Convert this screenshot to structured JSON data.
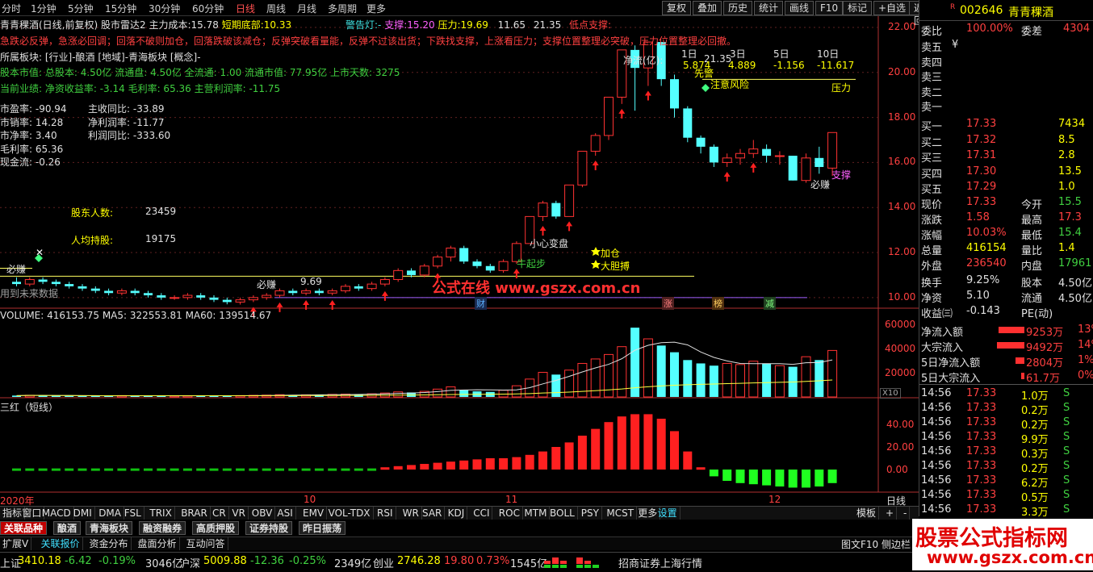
{
  "topbar": {
    "periods": [
      "分时",
      "1分钟",
      "5分钟",
      "15分钟",
      "30分钟",
      "60分钟",
      "日线",
      "周线",
      "月线",
      "多周期",
      "更多"
    ],
    "active": "日线",
    "buttons": [
      "复权",
      "叠加",
      "历史",
      "统计",
      "画线",
      "F10",
      "标记",
      "+自选",
      "返回"
    ]
  },
  "head": {
    "title": "青青稞酒(日线,前复权)",
    "indicator": "股市雷达2",
    "cost_label": "主力成本:",
    "cost": "15.78",
    "bottom_label": "短期底部:",
    "bottom": "10.33",
    "alarm": "警告灯:-",
    "support_label": "支撑:",
    "support": "15.20",
    "pressure_label": "压力:",
    "pressure": "19.69",
    "v1": "11.65",
    "v2": "21.35",
    "low_label": "低点支撑:"
  },
  "notice": "急跌必反弹，急涨必回调；回落不破则加仓，回落跌破该减仓；反弹突破看量能，反弹不过该出货；下跌找支撑，上涨看压力；支撑位置整理必突破，压力位置整理必回撤。",
  "sectors": "所属板块: [行业]-酿酒 [地域]-青海板块 [概念]-",
  "capital": "股本市值: 总股本: 4.50亿 流通盘: 4.50亿 全流通: 1.00 流通市值: 77.95亿 上市天数: 3275",
  "perf": "当前业绩: 净资收益率: -3.14 毛利率: 65.36 主营利润率: -11.75",
  "fin_left": [
    "市盈率: -90.94",
    "市销率: 14.28",
    "市净率: 3.40",
    "毛利率: 65.36",
    "现金流: -0.26"
  ],
  "fin_right": [
    "主收同比: -33.89",
    "净利润率: -11.77",
    "利润同比: -333.60"
  ],
  "holders": {
    "l1": "股东人数:",
    "v1": "23459",
    "l2": "人均持股:",
    "v2": "19175"
  },
  "netflow": {
    "label": "净流(亿):",
    "h1": "1日",
    "h3": "3日",
    "h5": "5日",
    "h10": "10日",
    "d1": "5.874",
    "d3": "4.889",
    "d5": "-1.156",
    "d10": "-11.617",
    "tag": "先警",
    "p21": "21.35"
  },
  "chart_text": {
    "risk": "注意风险",
    "pressure": "压力",
    "support": "支撑",
    "bimian": "必赚",
    "bimian2": "必赚",
    "bimian3": "必赚",
    "xiaoxin": "小心变盘",
    "jiacang": "加仓",
    "dadan": "大胆搏",
    "niuqi": "牛起步",
    "v969": "9.69",
    "future": "用到未来数据",
    "cai": "财",
    "zhang": "涨",
    "bang": "榜",
    "jian": "减",
    "watermark1": "公式在线 www.gszx.com.cn"
  },
  "yaxis": [
    "22.00",
    "20.00",
    "18.00",
    "16.00",
    "14.00",
    "12.00",
    "10.00"
  ],
  "volume": {
    "title": "VOLUME: 416153.75  MA5: 322553.81  MA60: 139514.67",
    "ticks": [
      "60000",
      "40000",
      "20000"
    ],
    "x10": "X10"
  },
  "sanhong": {
    "title": "三红（短线）",
    "ticks": [
      "40.00",
      "20.00",
      "0.00"
    ]
  },
  "xaxis": [
    "2020年",
    "10",
    "11",
    "12"
  ],
  "xaxis_right": "日线",
  "tabs": [
    "指标",
    "窗口",
    "MACD",
    "DMI",
    "DMA",
    "FSL",
    "TRIX",
    "BRAR",
    "CR",
    "VR",
    "OBV",
    "ASI",
    "EMV",
    "VOL-TDX",
    "RSI",
    "WR",
    "SAR",
    "KDJ",
    "CCI",
    "ROC",
    "MTM",
    "BOLL",
    "PSY",
    "MCST",
    "更多",
    "设置"
  ],
  "tabs_right": [
    "模板",
    "+",
    "-"
  ],
  "cats": [
    "关联品种",
    "酿酒",
    "青海板块",
    "融资融券",
    "高质押股",
    "证券持股",
    "昨日振荡"
  ],
  "infobar": [
    "扩展V",
    "关联报价",
    "资金分布",
    "盘面分析",
    "互动问答"
  ],
  "infobar_right": "图文F10 侧边栏",
  "status": {
    "sh_label": "上证",
    "sh": "3410.18",
    "sh_c": "-6.42",
    "sh_p": "-0.19%",
    "sh_v": "3046亿",
    "sz_label": "沪深",
    "sz": "5009.88",
    "sz_c": "-12.36",
    "sz_p": "-0.25%",
    "sz_v": "2349亿",
    "cy_label": "创业",
    "cy": "2746.28",
    "cy_c": "19.80",
    "cy_p": "0.73%",
    "cy_v": "1545亿",
    "broker": "招商证券上海行情"
  },
  "watermark2": {
    "l1": "股票公式指标网",
    "l2": "www.gszx.com.cn"
  },
  "right": {
    "code": "002646",
    "name": "青青稞酒",
    "r": "R",
    "wb": {
      "l": "委比",
      "v": "100.00%",
      "l2": "委差",
      "v2": "4304"
    },
    "asks": [
      {
        "l": "卖五",
        "p": "¥",
        "v": ""
      },
      {
        "l": "卖四",
        "p": "",
        "v": ""
      },
      {
        "l": "卖三",
        "p": "",
        "v": ""
      },
      {
        "l": "卖二",
        "p": "",
        "v": ""
      },
      {
        "l": "卖一",
        "p": "",
        "v": ""
      }
    ],
    "bids": [
      {
        "l": "买一",
        "p": "17.33",
        "v": "7434"
      },
      {
        "l": "买二",
        "p": "17.32",
        "v": "8.5"
      },
      {
        "l": "买三",
        "p": "17.31",
        "v": "2.8"
      },
      {
        "l": "买四",
        "p": "17.30",
        "v": "13.5"
      },
      {
        "l": "买五",
        "p": "17.29",
        "v": "1.0"
      }
    ],
    "quote": [
      {
        "l": "现价",
        "v": "17.33",
        "l2": "今开",
        "v2": "15.5"
      },
      {
        "l": "涨跌",
        "v": "1.58",
        "l2": "最高",
        "v2": "17.3"
      },
      {
        "l": "涨幅",
        "v": "10.03%",
        "l2": "最低",
        "v2": "15.4"
      },
      {
        "l": "总量",
        "v": "416154",
        "l2": "量比",
        "v2": "1.4"
      },
      {
        "l": "外盘",
        "v": "236540",
        "l2": "内盘",
        "v2": "17961"
      }
    ],
    "quote2": [
      {
        "l": "换手",
        "v": "9.25%",
        "l2": "股本",
        "v2": "4.50亿"
      },
      {
        "l": "净资",
        "v": "5.10",
        "l2": "流通",
        "v2": "4.50亿"
      },
      {
        "l": "收益㈢",
        "v": "-0.143",
        "l2": "PE(动)",
        "v2": ""
      }
    ],
    "flows": [
      {
        "l": "净流入额",
        "v": "9253万",
        "p": "13%",
        "bar": 0.9
      },
      {
        "l": "大宗流入",
        "v": "9492万",
        "p": "14%",
        "bar": 0.95
      },
      {
        "l": "5日净流入额",
        "v": "2804万",
        "p": "1%",
        "bar": 0.3
      },
      {
        "l": "5日大宗流入",
        "v": "61.7万",
        "p": "0%",
        "bar": 0.1
      }
    ],
    "ticks": [
      {
        "t": "14:56",
        "p": "17.33",
        "v": "1.0万",
        "s": "S"
      },
      {
        "t": "14:56",
        "p": "17.33",
        "v": "0.2万",
        "s": "S"
      },
      {
        "t": "14:56",
        "p": "17.33",
        "v": "0.2万",
        "s": "S"
      },
      {
        "t": "14:56",
        "p": "17.33",
        "v": "9.9万",
        "s": "S"
      },
      {
        "t": "14:56",
        "p": "17.33",
        "v": "0.3万",
        "s": "S"
      },
      {
        "t": "14:56",
        "p": "17.33",
        "v": "0.2万",
        "s": "S"
      },
      {
        "t": "14:56",
        "p": "17.33",
        "v": "6.2万",
        "s": "S"
      },
      {
        "t": "14:56",
        "p": "17.33",
        "v": "0.5万",
        "s": "S"
      },
      {
        "t": "14:56",
        "p": "17.33",
        "v": "3.3万",
        "s": "S"
      }
    ]
  },
  "colors": {
    "up": "#ff3232",
    "down": "#54ffff",
    "ma": "#ffff40",
    "bg": "#000000"
  },
  "chart_data": {
    "type": "candlestick",
    "price": [
      [
        10.7,
        10.6,
        10.9,
        10.5
      ],
      [
        10.6,
        10.8,
        10.9,
        10.5
      ],
      [
        10.8,
        10.7,
        10.9,
        10.6
      ],
      [
        10.7,
        10.6,
        10.8,
        10.5
      ],
      [
        10.6,
        10.5,
        10.7,
        10.4
      ],
      [
        10.5,
        10.4,
        10.6,
        10.3
      ],
      [
        10.4,
        10.3,
        10.5,
        10.2
      ],
      [
        10.3,
        10.2,
        10.4,
        10.1
      ],
      [
        10.2,
        10.3,
        10.4,
        10.1
      ],
      [
        10.3,
        10.2,
        10.4,
        10.1
      ],
      [
        10.2,
        10.1,
        10.3,
        10.0
      ],
      [
        10.1,
        10.0,
        10.2,
        9.9
      ],
      [
        10.0,
        10.0,
        10.1,
        9.9
      ],
      [
        10.0,
        10.1,
        10.2,
        9.9
      ],
      [
        10.1,
        10.0,
        10.2,
        9.9
      ],
      [
        10.0,
        9.9,
        10.1,
        9.8
      ],
      [
        9.9,
        9.8,
        10.0,
        9.7
      ],
      [
        9.8,
        9.9,
        10.0,
        9.69
      ],
      [
        9.9,
        10.0,
        10.1,
        9.8
      ],
      [
        10.0,
        10.1,
        10.2,
        9.9
      ],
      [
        10.1,
        10.3,
        10.4,
        10.0
      ],
      [
        10.3,
        10.2,
        10.4,
        10.1
      ],
      [
        10.2,
        10.3,
        10.4,
        10.1
      ],
      [
        10.3,
        10.2,
        10.4,
        10.1
      ],
      [
        10.2,
        10.3,
        10.4,
        10.1
      ],
      [
        10.3,
        10.5,
        10.6,
        10.2
      ],
      [
        10.5,
        10.4,
        10.6,
        10.3
      ],
      [
        10.4,
        10.6,
        10.7,
        10.3
      ],
      [
        10.6,
        10.8,
        10.9,
        10.5
      ],
      [
        10.8,
        11.2,
        11.3,
        10.7
      ],
      [
        11.2,
        11.0,
        11.3,
        10.9
      ],
      [
        11.0,
        11.4,
        11.5,
        10.9
      ],
      [
        11.4,
        11.8,
        11.9,
        11.3
      ],
      [
        11.8,
        12.2,
        12.3,
        11.6
      ],
      [
        12.2,
        11.6,
        12.3,
        11.5
      ],
      [
        11.6,
        11.4,
        11.7,
        11.3
      ],
      [
        11.4,
        11.2,
        11.5,
        11.1
      ],
      [
        11.2,
        11.6,
        11.7,
        11.1
      ],
      [
        11.6,
        12.4,
        12.5,
        11.5
      ],
      [
        12.4,
        13.6,
        13.6,
        12.4
      ],
      [
        13.6,
        14.2,
        14.3,
        13.4
      ],
      [
        14.2,
        13.6,
        14.3,
        13.5
      ],
      [
        13.6,
        15.0,
        15.0,
        13.6
      ],
      [
        15.0,
        16.5,
        16.5,
        14.9
      ],
      [
        16.5,
        17.2,
        17.3,
        16.3
      ],
      [
        17.2,
        18.9,
        18.9,
        17.0
      ],
      [
        18.9,
        21.0,
        21.0,
        18.6
      ],
      [
        21.0,
        20.2,
        21.2,
        18.3
      ],
      [
        20.2,
        21.35,
        21.35,
        19.4
      ],
      [
        21.35,
        19.7,
        21.35,
        19.4
      ],
      [
        19.7,
        18.4,
        19.9,
        18.0
      ],
      [
        18.4,
        17.1,
        18.5,
        16.9
      ],
      [
        17.1,
        16.7,
        17.2,
        16.4
      ],
      [
        16.7,
        16.0,
        16.8,
        15.8
      ],
      [
        16.0,
        16.2,
        16.4,
        15.8
      ],
      [
        16.2,
        16.4,
        16.6,
        15.9
      ],
      [
        16.4,
        16.6,
        17.0,
        16.2
      ],
      [
        16.6,
        16.3,
        16.8,
        16.0
      ],
      [
        16.3,
        16.3,
        16.5,
        15.9
      ],
      [
        16.3,
        15.2,
        16.3,
        15.2
      ],
      [
        15.2,
        16.2,
        16.4,
        15.1
      ],
      [
        16.2,
        15.8,
        16.7,
        15.5
      ],
      [
        15.75,
        17.33,
        17.33,
        15.4
      ]
    ],
    "volume": [
      1200,
      1500,
      1300,
      1100,
      1000,
      900,
      950,
      1000,
      1200,
      1100,
      900,
      1000,
      950,
      1100,
      1300,
      1000,
      900,
      1200,
      1400,
      1600,
      2000,
      1800,
      1900,
      2100,
      2300,
      2500,
      2400,
      2800,
      3500,
      4500,
      4000,
      5000,
      7000,
      9000,
      6000,
      5000,
      4500,
      6000,
      10000,
      16000,
      22000,
      20000,
      24000,
      30000,
      34000,
      38000,
      45000,
      62000,
      52000,
      46000,
      40000,
      33000,
      30000,
      28000,
      30000,
      29000,
      32000,
      30000,
      28000,
      27000,
      36000,
      33000,
      41600
    ],
    "ma5_desc": "MA5 line over volume",
    "sanhong": [
      1,
      1,
      1,
      1,
      1,
      1,
      1,
      1,
      1,
      1,
      1,
      1,
      1,
      1,
      1,
      1,
      1,
      1,
      1,
      1,
      1,
      1,
      1,
      1,
      1,
      1,
      1,
      1,
      2,
      3,
      4,
      5,
      6,
      7,
      8,
      9,
      10,
      10,
      11,
      13,
      16,
      20,
      24,
      30,
      36,
      42,
      47,
      49,
      49,
      45,
      34,
      16,
      2,
      -6,
      -10,
      -12,
      -13,
      -14,
      -15,
      -16,
      -16,
      -15,
      -12
    ],
    "ylim": [
      9.6,
      22.5
    ]
  }
}
